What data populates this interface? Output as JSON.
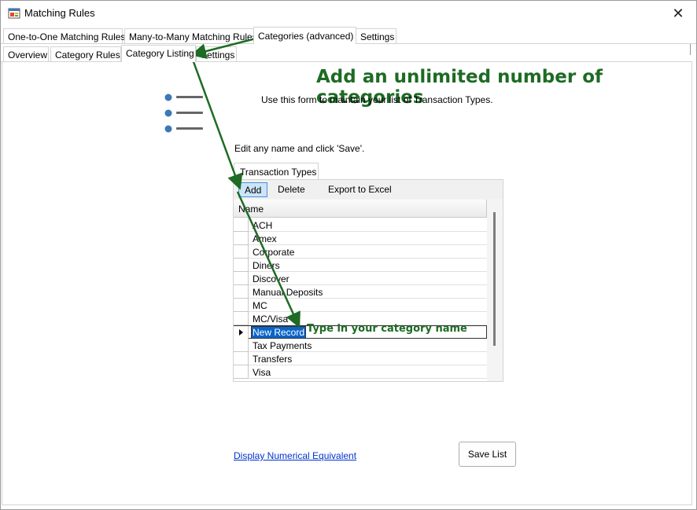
{
  "window": {
    "title": "Matching Rules",
    "close_label": "✕"
  },
  "tabs_top": [
    {
      "label": "One-to-One Matching Rules"
    },
    {
      "label": "Many-to-Many Matching Rules"
    },
    {
      "label": "Categories (advanced)",
      "active": true
    },
    {
      "label": "Settings"
    }
  ],
  "tabs_sub": [
    {
      "label": "Overview"
    },
    {
      "label": "Category Rules"
    },
    {
      "label": "Category Listing",
      "active": true
    },
    {
      "label": "Settings"
    }
  ],
  "headline": "Add an unlimited number of categories",
  "intro": "Use this form to maintain your list of Transaction Types.",
  "edit_hint": "Edit any name and click 'Save'.",
  "grid_tab": "Transaction Types",
  "toolbar": {
    "add": "Add",
    "delete": "Delete",
    "export": "Export to Excel"
  },
  "grid": {
    "column_header": "Name",
    "rows": [
      "ACH",
      "Amex",
      "Corporate",
      "Diners",
      "Discover",
      "Manual Deposits",
      "MC",
      "MC/Visa",
      "New Record",
      "Tax Payments",
      "Transfers",
      "Visa"
    ],
    "editing_row_index": 8
  },
  "callout": "Type in your category name",
  "link_label": "Display Numerical Equivalent",
  "save_label": "Save List",
  "colors": {
    "annotation_green": "#1e6b24",
    "selection_blue": "#0a64c8",
    "link_blue": "#0033cc",
    "icon_blue": "#3b78b8"
  },
  "icons": {
    "app": "app-window-icon",
    "list": "bulleted-list-icon",
    "close": "close-icon",
    "current_row": "row-pointer-icon"
  }
}
